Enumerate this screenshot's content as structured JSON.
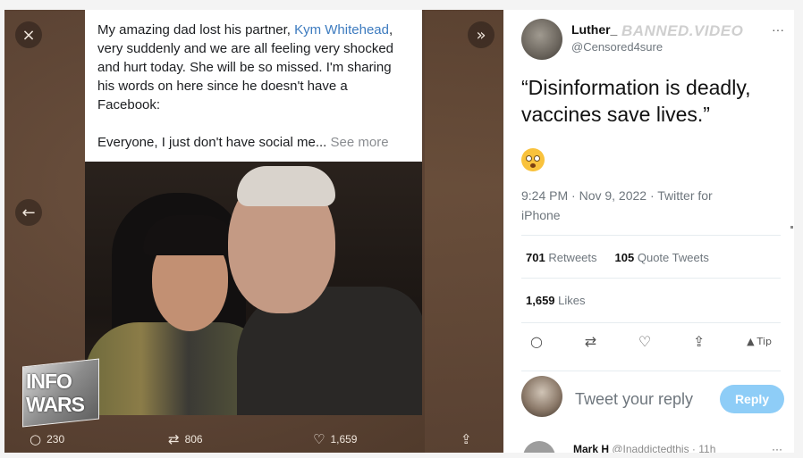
{
  "viewer": {
    "close_icon": "×",
    "expand_icon": "»",
    "back_icon": "←"
  },
  "post": {
    "text_before": "My amazing dad lost his partner, ",
    "link_text": "Kym Whitehead",
    "text_after": ", very suddenly and we are all feeling very shocked and hurt today. She will be so missed. I'm sharing his words on here since he doesn't have a Facebook:\n\nEveryone, I just don't have social me... ",
    "see_more": "See more"
  },
  "overlay": {
    "logo_line1": "INFO",
    "logo_line2": "WARS"
  },
  "actions": {
    "replies": "230",
    "retweets": "806",
    "likes": "1,659"
  },
  "tweet": {
    "name": "Luther_",
    "watermark": "BANNED.VIDEO",
    "handle": "@Censored4sure",
    "text": "“Disinformation is deadly, vaccines save lives.”",
    "timestamp": "9:24 PM · Nov 9, 2022 · Twitter for iPhone",
    "retweets_count": "701",
    "retweets_label": "Retweets",
    "quotes_count": "105",
    "quotes_label": "Quote Tweets",
    "likes_count": "1,659",
    "likes_label": "Likes",
    "tip_label": "Tip",
    "reply_prompt": "Tweet your reply",
    "reply_button": "Reply",
    "next_reply_name": "Mark H",
    "next_reply_meta": "@Inaddictedthis · 11h",
    "more_icon": "···"
  }
}
